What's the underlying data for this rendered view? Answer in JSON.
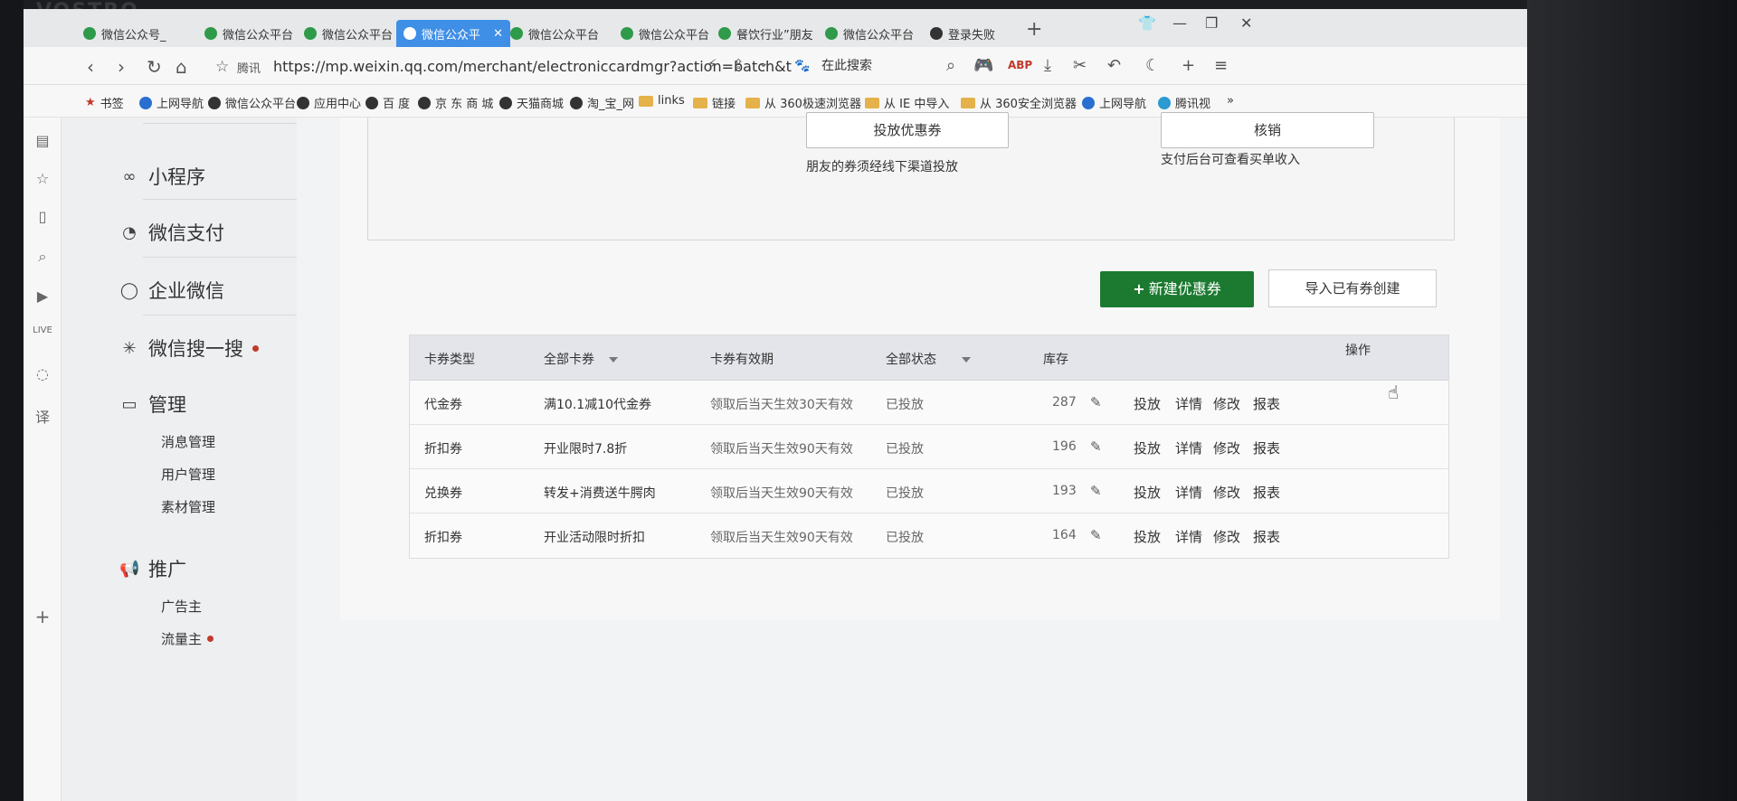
{
  "device": {
    "brand": "VOSTRO"
  },
  "browser": {
    "tabs": [
      {
        "label": "微信公众号_"
      },
      {
        "label": "微信公众平台"
      },
      {
        "label": "微信公众平台"
      },
      {
        "label": "微信公众平",
        "active": true
      },
      {
        "label": "微信公众平台"
      },
      {
        "label": "微信公众平台"
      },
      {
        "label": "餐饮行业”朋友"
      },
      {
        "label": "微信公众平台"
      },
      {
        "label": "登录失败"
      }
    ],
    "new_tab": "+",
    "address": {
      "site_label": "腾讯",
      "url": "https://mp.weixin.qq.com/merchant/electroniccardmgr?action=batch&t"
    },
    "search": {
      "placeholder": "在此搜索"
    },
    "bookmarks": [
      {
        "label": "书签"
      },
      {
        "label": "上网导航"
      },
      {
        "label": "微信公众平台"
      },
      {
        "label": "应用中心"
      },
      {
        "label": "百 度"
      },
      {
        "label": "京 东 商 城"
      },
      {
        "label": "天猫商城"
      },
      {
        "label": "淘_宝_网"
      },
      {
        "label": "links"
      },
      {
        "label": "链接"
      },
      {
        "label": "从 360极速浏览器"
      },
      {
        "label": "从 IE 中导入"
      },
      {
        "label": "从 360安全浏览器"
      },
      {
        "label": "上网导航"
      },
      {
        "label": "腾讯视"
      }
    ]
  },
  "menu": {
    "items": [
      {
        "label": "小程序"
      },
      {
        "label": "微信支付"
      },
      {
        "label": "企业微信"
      },
      {
        "label": "微信搜一搜"
      },
      {
        "label": "管理"
      },
      {
        "label": "推广"
      }
    ],
    "manage_sub": [
      "消息管理",
      "用户管理",
      "素材管理"
    ],
    "promo_sub": [
      "广告主",
      "流量主"
    ]
  },
  "top_actions": {
    "distribute_button": "投放优惠券",
    "distribute_hint": "朋友的券须经线下渠道投放",
    "verify_button": "核销",
    "verify_hint": "支付后台可查看买单收入"
  },
  "toolbar": {
    "new_coupon": "新建优惠券",
    "import_coupon": "导入已有券创建"
  },
  "table": {
    "headers": [
      "卡券类型",
      "全部卡券",
      "卡券有效期",
      "全部状态",
      "库存",
      "操作"
    ],
    "rows": [
      {
        "type": "代金券",
        "name": "满10.1减10代金券",
        "validity": "领取后当天生效30天有效",
        "status": "已投放",
        "stock": "287"
      },
      {
        "type": "折扣券",
        "name": "开业限时7.8折",
        "validity": "领取后当天生效90天有效",
        "status": "已投放",
        "stock": "196"
      },
      {
        "type": "兑换券",
        "name": "转发+消费送牛腭肉",
        "validity": "领取后当天生效90天有效",
        "status": "已投放",
        "stock": "193"
      },
      {
        "type": "折扣券",
        "name": "开业活动限时折扣",
        "validity": "领取后当天生效90天有效",
        "status": "已投放",
        "stock": "164"
      }
    ],
    "actions": [
      "投放",
      "详情",
      "修改",
      "报表"
    ]
  }
}
